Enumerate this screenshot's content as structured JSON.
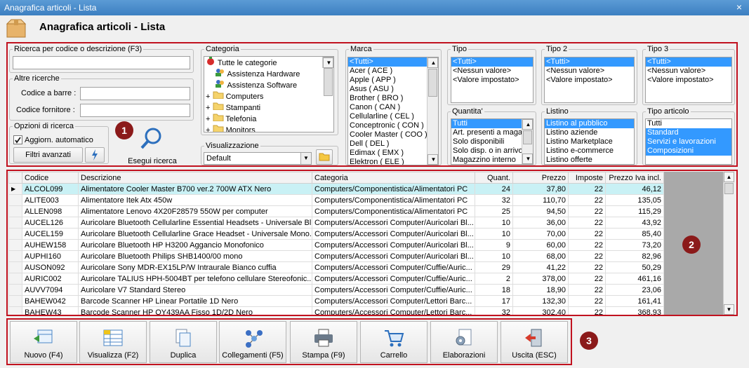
{
  "window": {
    "title": "Anagrafica articoli  - Lista",
    "heading": "Anagrafica articoli  - Lista",
    "close": "×"
  },
  "search": {
    "legend": "Ricerca per codice o descrizione (F3)",
    "value": ""
  },
  "altre": {
    "legend": "Altre ricerche",
    "barcode_label": "Codice a barre :",
    "supplier_label": "Codice fornitore :"
  },
  "opzioni": {
    "legend": "Opzioni di ricerca",
    "auto_label": "Aggiorn. automatico",
    "filtri": "Filtri avanzati",
    "esegui": "Esegui ricerca"
  },
  "categoria": {
    "legend": "Categoria",
    "items": [
      "Tutte le categorie",
      "Assistenza Hardware",
      "Assistenza Software",
      "Computers",
      "Stampanti",
      "Telefonia",
      "Monitors"
    ],
    "expanders": [
      "",
      "",
      "",
      "+",
      "+",
      "+",
      "+"
    ]
  },
  "visualizzazione": {
    "legend": "Visualizzazione",
    "value": "Default"
  },
  "marca": {
    "legend": "Marca",
    "items": [
      "<Tutti>",
      "Acer ( ACE )",
      "Apple ( APP )",
      "Asus ( ASU )",
      "Brother ( BRO )",
      "Canon ( CAN )",
      "Cellularline ( CEL )",
      "Conceptronic ( CON )",
      "Cooler Master ( COO )",
      "Dell ( DEL )",
      "Edimax ( EMX )",
      "Elektron ( ELE )"
    ]
  },
  "tipo": {
    "legend": "Tipo",
    "items": [
      "<Tutti>",
      "<Nessun valore>",
      "<Valore impostato>"
    ]
  },
  "tipo2": {
    "legend": "Tipo 2",
    "items": [
      "<Tutti>",
      "<Nessun valore>",
      "<Valore impostato>"
    ]
  },
  "tipo3": {
    "legend": "Tipo 3",
    "items": [
      "<Tutti>",
      "<Nessun valore>",
      "<Valore impostato>"
    ]
  },
  "quantita": {
    "legend": "Quantita'",
    "items": [
      "Tutti",
      "Art. presenti a magazzino",
      "Solo disponibili",
      "Solo disp. o in arrivo",
      "Magazzino interno"
    ]
  },
  "listino": {
    "legend": "Listino",
    "items": [
      "Listino al pubblico",
      "Listino aziende",
      "Listino Marketplace",
      "Listino e-commerce",
      "Listino offerte"
    ]
  },
  "tipoart": {
    "legend": "Tipo articolo",
    "items": [
      "Tutti",
      "Standard",
      "Servizi e lavorazioni",
      "Composizioni"
    ]
  },
  "grid": {
    "headers": [
      "Codice",
      "Descrizione",
      "Categoria",
      "Quant.",
      "Prezzo",
      "Imposte",
      "Prezzo Iva incl."
    ],
    "rows": [
      [
        "ALCOL099",
        "Alimentatore Cooler Master B700 ver.2 700W ATX Nero",
        "Computers/Componentistica/Alimentatori PC",
        "24",
        "37,80",
        "22",
        "46,12"
      ],
      [
        "ALITE003",
        "Alimentatore Itek Atx 450w",
        "Computers/Componentistica/Alimentatori PC",
        "32",
        "110,70",
        "22",
        "135,05"
      ],
      [
        "ALLEN098",
        "Alimentatore Lenovo 4X20F28579 550W per computer",
        "Computers/Componentistica/Alimentatori PC",
        "25",
        "94,50",
        "22",
        "115,29"
      ],
      [
        "AUCEL126",
        "Auricolare Bluetooth Cellularline Essential Headsets - Universale Blu",
        "Computers/Accessori Computer/Auricolari Bl...",
        "10",
        "36,00",
        "22",
        "43,92"
      ],
      [
        "AUCEL159",
        "Auricolare Bluetooth Cellularline Grace Headset - Universale Mono...",
        "Computers/Accessori Computer/Auricolari Bl...",
        "10",
        "70,00",
        "22",
        "85,40"
      ],
      [
        "AUHEW158",
        "Auricolare Bluetooth HP H3200 Aggancio Monofonico",
        "Computers/Accessori Computer/Auricolari Bl...",
        "9",
        "60,00",
        "22",
        "73,20"
      ],
      [
        "AUPHI160",
        "Auricolare Bluetooth Philips SHB1400/00 mono",
        "Computers/Accessori Computer/Auricolari Bl...",
        "10",
        "68,00",
        "22",
        "82,96"
      ],
      [
        "AUSON092",
        "Auricolare Sony MDR-EX15LP/W Intraurale Bianco cuffia",
        "Computers/Accessori Computer/Cuffie/Auric...",
        "29",
        "41,22",
        "22",
        "50,29"
      ],
      [
        "AURIC002",
        "Auricolare TALIUS HPH-5004BT per telefono cellulare Stereofonic...",
        "Computers/Accessori Computer/Cuffie/Auric...",
        "2",
        "378,00",
        "22",
        "461,16"
      ],
      [
        "AUVV7094",
        "Auricolare V7 Standard Stereo",
        "Computers/Accessori Computer/Cuffie/Auric...",
        "18",
        "18,90",
        "22",
        "23,06"
      ],
      [
        "BAHEW042",
        "Barcode Scanner HP Linear Portatile 1D Nero",
        "Computers/Accessori Computer/Lettori Barc...",
        "17",
        "132,30",
        "22",
        "161,41"
      ],
      [
        "BAHEW43",
        "Barcode Scanner HP QY439AA Fisso 1D/2D Nero",
        "Computers/Accessori Computer/Lettori Barc...",
        "32",
        "302,40",
        "22",
        "368,93"
      ]
    ]
  },
  "badges": [
    "1",
    "2",
    "3"
  ],
  "toolbar": [
    "Nuovo (F4)",
    "Visualizza (F2)",
    "Duplica",
    "Collegamenti (F5)",
    "Stampa (F9)",
    "Carrello",
    "Elaborazioni",
    "Uscita (ESC)"
  ]
}
